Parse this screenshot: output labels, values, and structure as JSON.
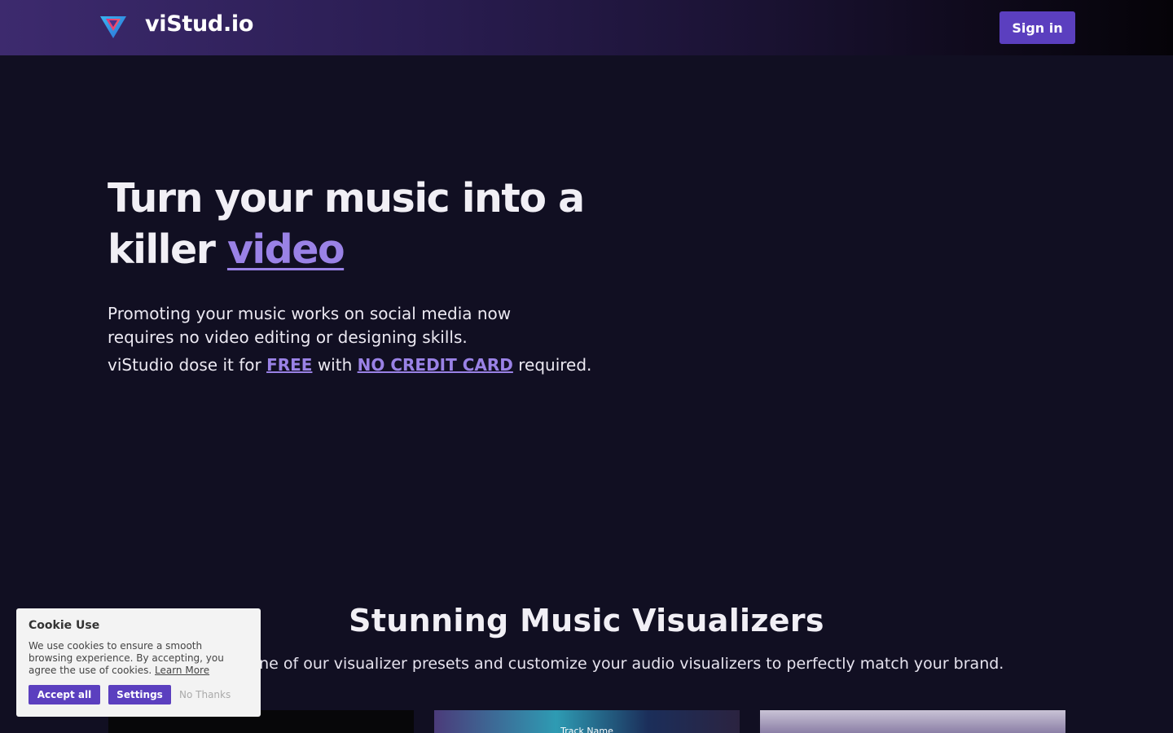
{
  "header": {
    "brand": "viStud.io",
    "signin_label": "Sign in"
  },
  "hero": {
    "title_line1": "Turn your music into a",
    "title_line2_prefix": "killer ",
    "title_accent": "video",
    "subtitle": "Promoting your music works on social media now requires no video editing or designing skills.",
    "tagline_prefix": "viStudio dose it for ",
    "tagline_free": "FREE",
    "tagline_mid": " with ",
    "tagline_nocard": "NO CREDIT CARD",
    "tagline_suffix": " required."
  },
  "section": {
    "title": "Stunning Music Visualizers",
    "description": "Start with one of our visualizer presets and customize your audio visualizers to perfectly match your brand."
  },
  "thumbnails": {
    "track_name": "Track Name"
  },
  "cookie": {
    "title": "Cookie Use",
    "text": "We use cookies to ensure a smooth browsing experience. By accepting, you agree the use of cookies. ",
    "learn_more": "Learn More",
    "accept_label": "Accept all",
    "settings_label": "Settings",
    "nothanks_label": "No Thanks"
  },
  "colors": {
    "accent": "#9a82e6",
    "button": "#5b3fbf",
    "background": "#110f22"
  },
  "icons": {
    "logo": "vistudio-logo-icon"
  }
}
